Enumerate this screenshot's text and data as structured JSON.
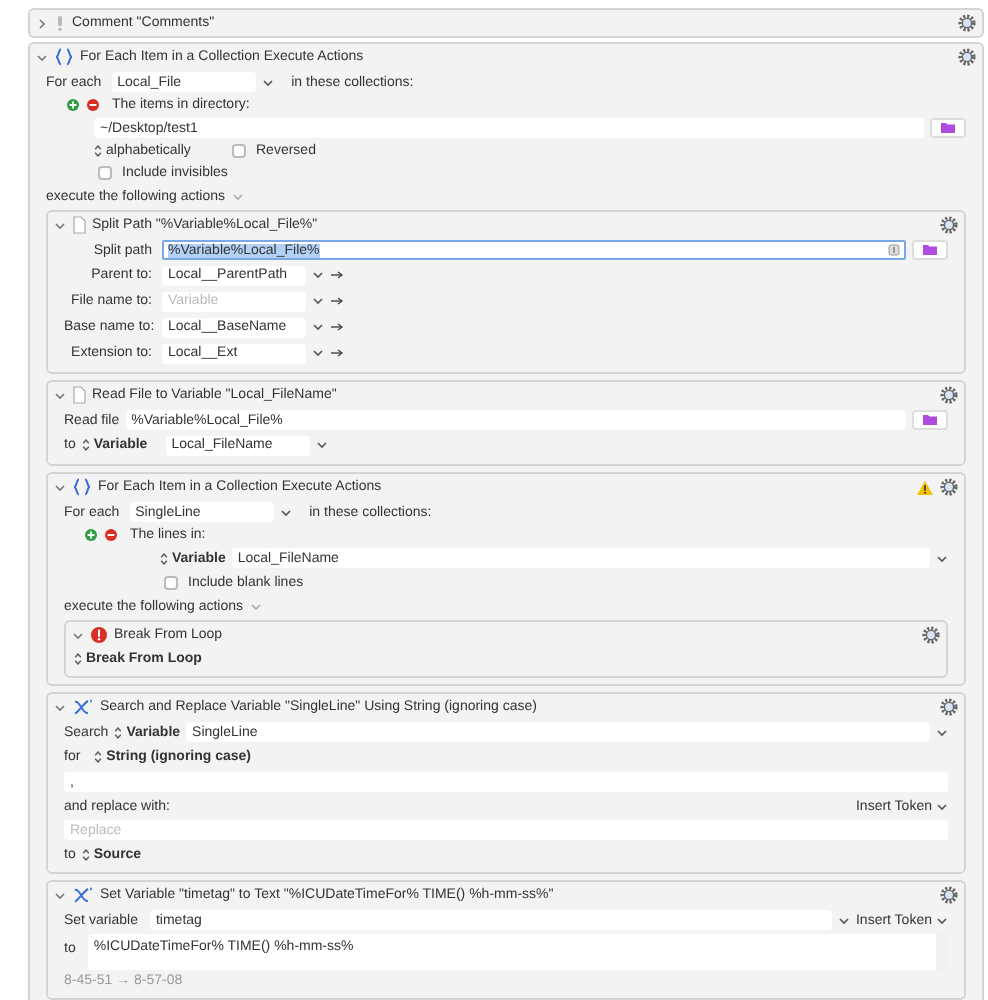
{
  "actions": [
    {
      "kind": "comment",
      "title": "Comment \"Comments\"",
      "expanded": false
    },
    {
      "kind": "for_each",
      "title": "For Each Item in a Collection Execute Actions",
      "expanded": true,
      "warning": false,
      "for_each": {
        "label": "For each",
        "value": "Local_File",
        "suffix": "in these collections:"
      },
      "collection": {
        "kind": "directory",
        "label": "The items in directory:",
        "path": "~/Desktop/test1",
        "sort": "alphabetically",
        "options": [
          {
            "label": "Reversed",
            "checked": false
          },
          {
            "label": "Include invisibles",
            "checked": false
          }
        ]
      },
      "execute_label": "execute the following actions",
      "actions": [
        {
          "kind": "split_path",
          "title": "Split Path \"%Variable%Local_File%\"",
          "expanded": true,
          "path": {
            "label": "Split path",
            "value": "%Variable%Local_File%",
            "selected": true
          },
          "outputs": [
            {
              "label": "Parent to:",
              "value": "Local__ParentPath"
            },
            {
              "label": "File name to:",
              "placeholder": "Variable"
            },
            {
              "label": "Base name to:",
              "value": "Local__BaseName"
            },
            {
              "label": "Extension to:",
              "value": "Local__Ext"
            }
          ]
        },
        {
          "kind": "read_file",
          "title": "Read File to Variable \"Local_FileName\"",
          "expanded": true,
          "file": {
            "label": "Read file",
            "value": "%Variable%Local_File%"
          },
          "target": {
            "label": "to",
            "type": "Variable",
            "value": "Local_FileName"
          }
        },
        {
          "kind": "for_each",
          "title": "For Each Item in a Collection Execute Actions",
          "expanded": true,
          "warning": true,
          "for_each": {
            "label": "For each",
            "value": "SingleLine",
            "suffix": "in these collections:"
          },
          "collection": {
            "kind": "lines",
            "label": "The lines in:",
            "type": "Variable",
            "value": "Local_FileName",
            "options": [
              {
                "label": "Include blank lines",
                "checked": false
              }
            ]
          },
          "execute_label": "execute the following actions",
          "actions": [
            {
              "kind": "break",
              "title": "Break From Loop",
              "expanded": true,
              "option": "Break From Loop"
            }
          ]
        },
        {
          "kind": "search_replace",
          "title": "Search and Replace Variable \"SingleLine\" Using String (ignoring case)",
          "expanded": true,
          "search": {
            "label": "Search",
            "type": "Variable",
            "value": "SingleLine"
          },
          "for": {
            "label": "for",
            "type": "String (ignoring case)",
            "value": ","
          },
          "replace": {
            "label": "and replace with:",
            "token_button": "Insert Token",
            "placeholder": "Replace"
          },
          "to": {
            "label": "to",
            "type": "Source"
          }
        },
        {
          "kind": "set_variable",
          "title": "Set Variable \"timetag\" to Text \"%ICUDateTimeFor% TIME() %h-mm-ss%\"",
          "expanded": true,
          "variable": {
            "label": "Set variable",
            "value": "timetag"
          },
          "token_button": "Insert Token",
          "to": {
            "label": "to",
            "value": "%ICUDateTimeFor% TIME() %h-mm-ss%"
          },
          "preview": "8-45-51 → 8-57-08"
        }
      ]
    }
  ]
}
